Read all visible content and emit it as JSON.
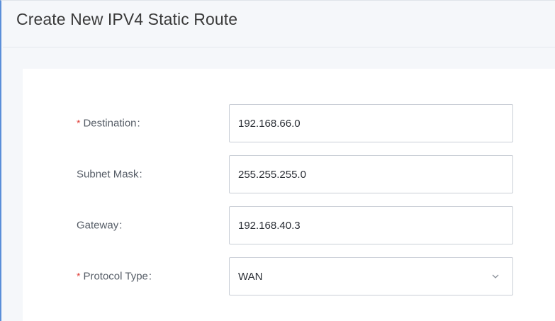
{
  "dialog": {
    "title": "Create New IPV4 Static Route"
  },
  "form": {
    "destination": {
      "label": "Destination",
      "required_mark": "*",
      "colon": ":",
      "value": "192.168.66.0"
    },
    "subnet_mask": {
      "label": "Subnet Mask",
      "colon": ":",
      "value": "255.255.255.0"
    },
    "gateway": {
      "label": "Gateway",
      "colon": ":",
      "value": "192.168.40.3"
    },
    "protocol_type": {
      "label": "Protocol Type",
      "required_mark": "*",
      "colon": ":",
      "value": "WAN",
      "icon": "chevron-down-icon"
    }
  },
  "colors": {
    "accent_border": "#5b8fd9",
    "required": "#e0403a",
    "background": "#f5f7fa",
    "card": "#ffffff"
  }
}
